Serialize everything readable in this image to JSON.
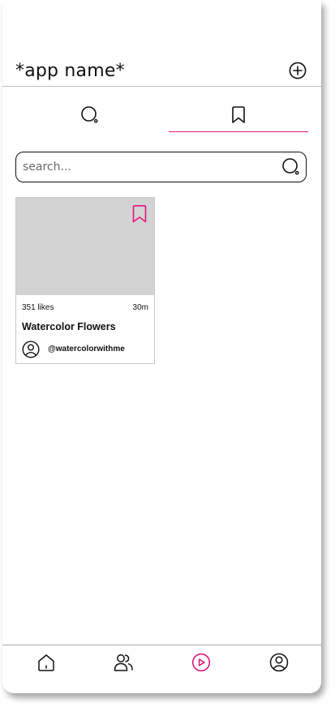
{
  "header": {
    "title": "*app name*",
    "add_icon": "plus-circle-icon"
  },
  "tabs": [
    {
      "id": "search",
      "icon": "search-icon",
      "active": false
    },
    {
      "id": "saved",
      "icon": "bookmark-icon",
      "active": true
    }
  ],
  "search": {
    "placeholder": "search...",
    "value": ""
  },
  "posts": [
    {
      "likes": "351 likes",
      "time": "30m",
      "title": "Watercolor Flowers",
      "author": "@watercolorwithme",
      "saved": true
    }
  ],
  "bottom_nav": [
    {
      "id": "home",
      "icon": "home-icon",
      "active": false
    },
    {
      "id": "community",
      "icon": "people-icon",
      "active": false
    },
    {
      "id": "videos",
      "icon": "play-circle-icon",
      "active": true
    },
    {
      "id": "profile",
      "icon": "user-circle-icon",
      "active": false
    }
  ],
  "colors": {
    "accent": "#e0177d",
    "image_placeholder": "#d3d3d3",
    "text": "#111111"
  }
}
